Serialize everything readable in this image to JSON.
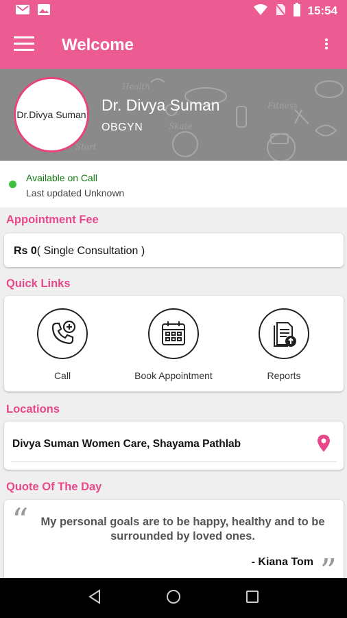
{
  "status_bar": {
    "time": "15:54"
  },
  "app_bar": {
    "title": "Welcome"
  },
  "profile": {
    "avatar_text": "Dr.Divya Suman",
    "name": "Dr. Divya Suman",
    "specialty": "OBGYN"
  },
  "availability": {
    "title": "Available on Call",
    "subtitle": "Last updated Unknown"
  },
  "appointment_fee": {
    "section_title": "Appointment Fee",
    "amount": "Rs 0",
    "detail": "( Single Consultation )"
  },
  "quick_links": {
    "section_title": "Quick Links",
    "items": [
      {
        "label": "Call",
        "icon": "phone-plus-icon"
      },
      {
        "label": "Book Appointment",
        "icon": "calendar-icon"
      },
      {
        "label": "Reports",
        "icon": "report-upload-icon"
      }
    ]
  },
  "locations": {
    "section_title": "Locations",
    "items": [
      {
        "name": "Divya Suman Women Care, Shayama Pathlab"
      }
    ]
  },
  "quote": {
    "section_title": "Quote Of The Day",
    "text": "My personal goals are to be happy, healthy and to be surrounded by loved ones.",
    "author": "- Kiana Tom"
  },
  "colors": {
    "primary": "#ec5c92",
    "accent": "#e8478a",
    "available": "#127a12"
  }
}
